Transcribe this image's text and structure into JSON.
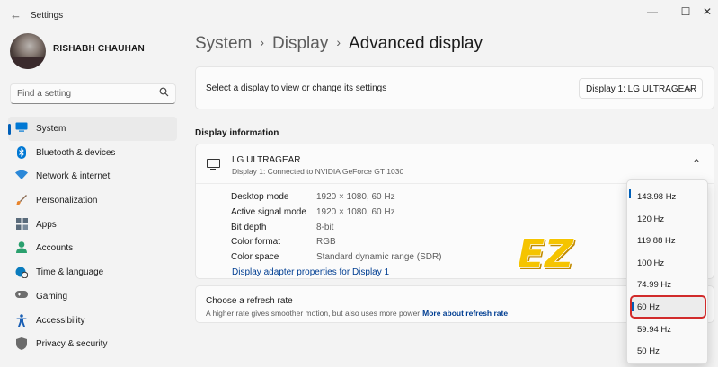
{
  "window": {
    "title": "Settings",
    "back_glyph": "←",
    "minimize_glyph": "—",
    "maximize_glyph": "☐",
    "close_glyph": "✕"
  },
  "user": {
    "name": "RISHABH CHAUHAN"
  },
  "search": {
    "placeholder": "Find a setting",
    "icon": "search-icon"
  },
  "sidebar": {
    "items": [
      {
        "label": "System",
        "icon": "system-display-icon",
        "color": "#0078d4",
        "active": true
      },
      {
        "label": "Bluetooth & devices",
        "icon": "bluetooth-icon",
        "color": "#0078d4"
      },
      {
        "label": "Network & internet",
        "icon": "wifi-icon",
        "color": "#2b88d8"
      },
      {
        "label": "Personalization",
        "icon": "brush-icon",
        "color": "#e8842c"
      },
      {
        "label": "Apps",
        "icon": "apps-icon",
        "color": "#5a6b7b"
      },
      {
        "label": "Accounts",
        "icon": "person-icon",
        "color": "#2aa06e"
      },
      {
        "label": "Time & language",
        "icon": "globe-clock-icon",
        "color": "#0a7cbe"
      },
      {
        "label": "Gaming",
        "icon": "gamepad-icon",
        "color": "#6d6d6d"
      },
      {
        "label": "Accessibility",
        "icon": "accessibility-icon",
        "color": "#1a5fb4"
      },
      {
        "label": "Privacy & security",
        "icon": "shield-icon",
        "color": "#6b6b6b"
      }
    ]
  },
  "breadcrumb": {
    "items": [
      "System",
      "Display"
    ],
    "separator": "›",
    "current": "Advanced display"
  },
  "select_display": {
    "text": "Select a display to view or change its settings",
    "value": "Display 1: LG ULTRAGEAR",
    "chevron": "⌄"
  },
  "display_information": {
    "section_title": "Display information",
    "monitor_name": "LG ULTRAGEAR",
    "monitor_sub": "Display 1: Connected to NVIDIA GeForce GT 1030",
    "collapse_glyph": "⌃",
    "rows": [
      {
        "key": "Desktop mode",
        "value": "1920 × 1080, 60 Hz"
      },
      {
        "key": "Active signal mode",
        "value": "1920 × 1080, 60 Hz"
      },
      {
        "key": "Bit depth",
        "value": "8-bit"
      },
      {
        "key": "Color format",
        "value": "RGB"
      },
      {
        "key": "Color space",
        "value": "Standard dynamic range (SDR)"
      }
    ],
    "adapter_link": "Display adapter properties for Display 1"
  },
  "refresh_rate": {
    "title": "Choose a refresh rate",
    "description": "A higher rate gives smoother motion, but also uses more power",
    "more_link": "More about refresh rate",
    "options": [
      "143.98 Hz",
      "120 Hz",
      "119.88 Hz",
      "100 Hz",
      "74.99 Hz",
      "60 Hz",
      "59.94 Hz",
      "50 Hz"
    ],
    "selected": "60 Hz"
  },
  "watermark": {
    "text": "EZ",
    "colors": {
      "fill": "#f5c400",
      "stroke": "#c18a00"
    }
  },
  "colors": {
    "accent": "#005fb8",
    "link": "#003e92",
    "highlight": "#d12b2b"
  }
}
